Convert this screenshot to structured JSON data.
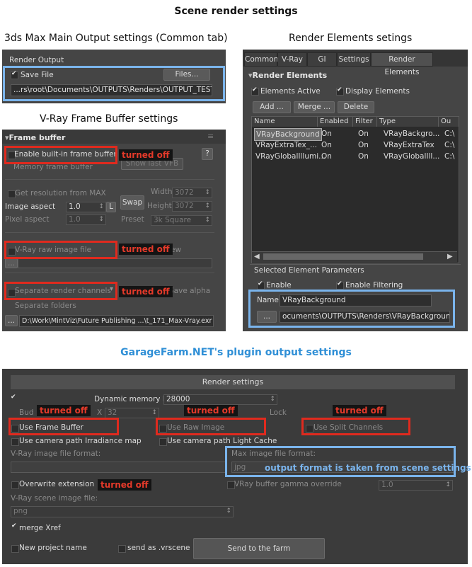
{
  "page_title": "Scene render settings",
  "common": {
    "title": "3ds Max Main Output settings (Common tab)",
    "render_output": "Render Output",
    "save_file": "Save File",
    "files_button": "Files...",
    "output_path": "...rs\\root\\Documents\\OUTPUTS\\Renders\\OUTPUT_TEST.jpg"
  },
  "render_elements": {
    "title": "Render Elements setings",
    "tabs": [
      "Common",
      "V-Ray",
      "GI",
      "Settings",
      "Render Elements"
    ],
    "section": "Render Elements",
    "elements_active": "Elements Active",
    "display_elements": "Display Elements",
    "add_button": "Add ...",
    "merge_button": "Merge ...",
    "delete_button": "Delete",
    "columns": [
      "Name",
      "Enabled",
      "Filter",
      "Type",
      "Ou"
    ],
    "rows": [
      [
        "VRayBackground",
        "On",
        "On",
        "VRayBackgro...",
        "C:\\"
      ],
      [
        "VRayExtraTex_...",
        "On",
        "On",
        "VRayExtraTex",
        "C:\\"
      ],
      [
        "VRayGlobalIllumi...",
        "On",
        "On",
        "VRayGlobalIll...",
        "C:\\"
      ]
    ],
    "selected_params": "Selected Element Parameters",
    "enable": "Enable",
    "enable_filtering": "Enable Filtering",
    "name_label": "Name:",
    "name_value": "VRayBackground",
    "browse_button": "...",
    "element_path": "ocuments\\OUTPUTS\\Renders\\VRayBackground.tif"
  },
  "vfb": {
    "title": "V-Ray Frame Buffer settings",
    "section": "Frame buffer",
    "enable_builtin": "Enable built-in frame buffer",
    "memory_fb": "Memory frame buffer",
    "show_last": "Show last VFB",
    "get_res": "Get resolution from MAX",
    "width_label": "Width",
    "width_value": "3072",
    "height_label": "Height",
    "height_value": "3072",
    "image_aspect": "Image aspect",
    "image_aspect_value": "1.0",
    "l_button": "L",
    "swap_button": "Swap",
    "pixel_aspect": "Pixel aspect",
    "pixel_aspect_value": "1.0",
    "preset_label": "Preset",
    "preset_value": "3k Square",
    "raw_file": "V-Ray raw image file",
    "raw_extra": "ew",
    "raw_browse": "...",
    "separate_channels": "Separate render channels",
    "save_alpha": "Save alpha",
    "separate_folders": "Separate folders",
    "channels_browse": "...",
    "channels_path": "D:\\Work\\MintViz\\Future Publishing ...\\t_171_Max-Vray.exr"
  },
  "garage": {
    "title": "GarageFarm.NET's plugin output settings",
    "render_settings": "Render settings",
    "dyn_mem_label": "Dynamic memory limit",
    "dyn_mem_value": "28000",
    "bud": "Bud",
    "bud_x": "X",
    "bud_x_value": "32",
    "lock": "Lock",
    "use_fb": "Use Frame Buffer",
    "use_raw": "Use Raw Image",
    "use_split": "Use Split Channels",
    "cam_irr": "Use camera path Irradiance map",
    "cam_lc": "Use camera path Light Cache",
    "vray_image_format": "V-Ray image file format:",
    "max_image_format": "Max image file format:",
    "max_image_value": "jpg",
    "overwrite_ext": "Overwrite extension",
    "gamma_override": "VRay buffer gamma override",
    "gamma_value": "1.0",
    "scene_image_file": "V-Ray scene image file:",
    "scene_image_value": "png",
    "merge_xref": "merge Xref",
    "new_project": "New project name",
    "send_vrscene": "send as .vrscene",
    "send_button": "Send to the farm"
  },
  "annotations": {
    "turned_off": "turned off",
    "output_note": "output format is taken from scene settings"
  },
  "colors": {
    "panel": "#454545",
    "red_highlight": "#e02a1e",
    "blue_highlight": "#7ab4ec",
    "garage_title": "#2f8fd6"
  }
}
